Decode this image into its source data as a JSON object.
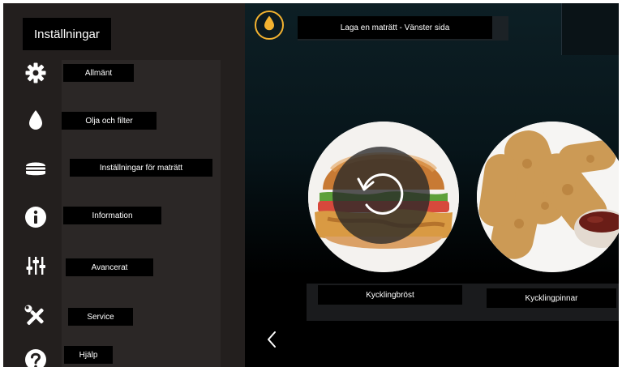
{
  "settings": {
    "title": "Inställningar",
    "items": [
      {
        "label": "Allmänt",
        "icon": "gear-icon"
      },
      {
        "label": "Olja och filter",
        "icon": "oil-drop-icon"
      },
      {
        "label": "Inställningar för maträtt",
        "icon": "burger-icon"
      },
      {
        "label": "Information",
        "icon": "info-icon"
      },
      {
        "label": "Avancerat",
        "icon": "sliders-icon"
      },
      {
        "label": "Service",
        "icon": "tools-icon"
      },
      {
        "label": "Hjälp",
        "icon": "help-icon"
      }
    ]
  },
  "cooking": {
    "header": "Laga en maträtt - Vänster sida",
    "oil_icon": "oil-drop-icon",
    "products": [
      {
        "label": "Kycklingbröst",
        "image": "chicken-burger-image"
      },
      {
        "label": "Kycklingpinnar",
        "image": "chicken-tenders-image"
      }
    ],
    "reset_icon": "reset-icon",
    "back_icon": "back-chevron-icon"
  },
  "colors": {
    "accent": "#f3b230",
    "sidebar_bg": "#231f1e",
    "label_bg": "#000000"
  }
}
